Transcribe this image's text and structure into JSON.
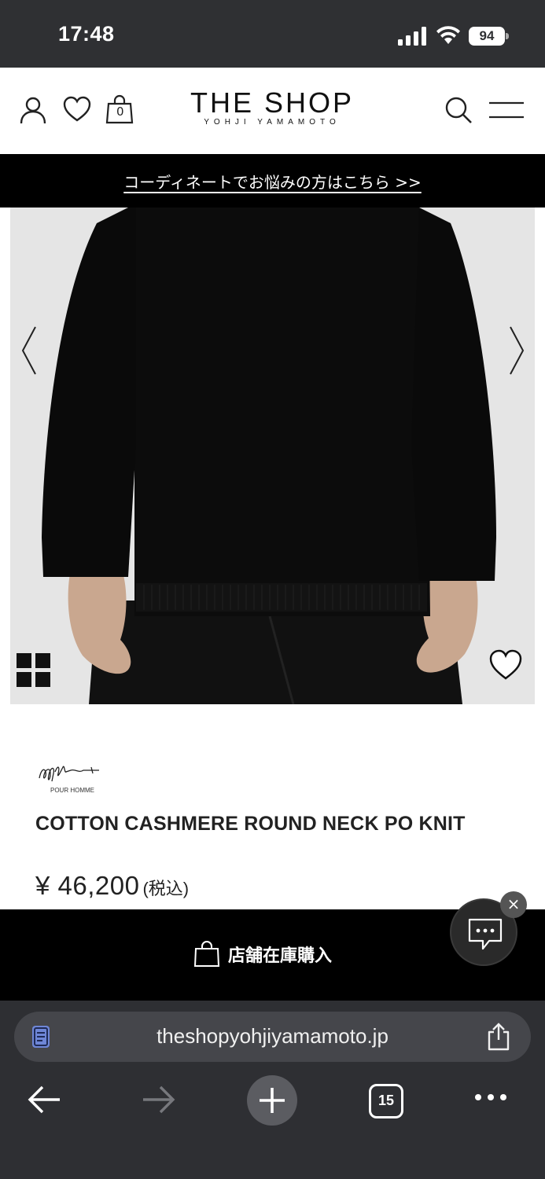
{
  "status_bar": {
    "time": "17:48",
    "battery": "94"
  },
  "header": {
    "logo_main": "THE SHOP",
    "logo_sub": "YOHJI YAMAMOTO",
    "bag_count": "0"
  },
  "promo": {
    "text": "コーディネートでお悩みの方はこちら >>"
  },
  "product": {
    "brand_sub": "POUR HOMME",
    "name": "COTTON CASHMERE ROUND NECK PO KNIT",
    "price": "¥ 46,200",
    "tax": "(税込)"
  },
  "purchase": {
    "label": "店舗在庫購入"
  },
  "chat": {
    "close": "×"
  },
  "browser": {
    "url": "theshopyohjiyamamoto.jp",
    "tab_count": "15"
  },
  "colors": {
    "status_bg": "#2f3033",
    "promo_bg": "#000000",
    "browser_bg": "#2e2f33",
    "url_bg": "#45464b"
  },
  "icons": [
    "signal-icon",
    "wifi-icon",
    "user-icon",
    "heart-icon",
    "bag-icon",
    "search-icon",
    "menu-icon",
    "chevron-left-icon",
    "chevron-right-icon",
    "grid-icon",
    "heart-icon",
    "shopping-bag-icon",
    "chat-icon",
    "page-icon",
    "share-icon",
    "back-icon",
    "forward-icon",
    "plus-icon",
    "more-icon"
  ]
}
